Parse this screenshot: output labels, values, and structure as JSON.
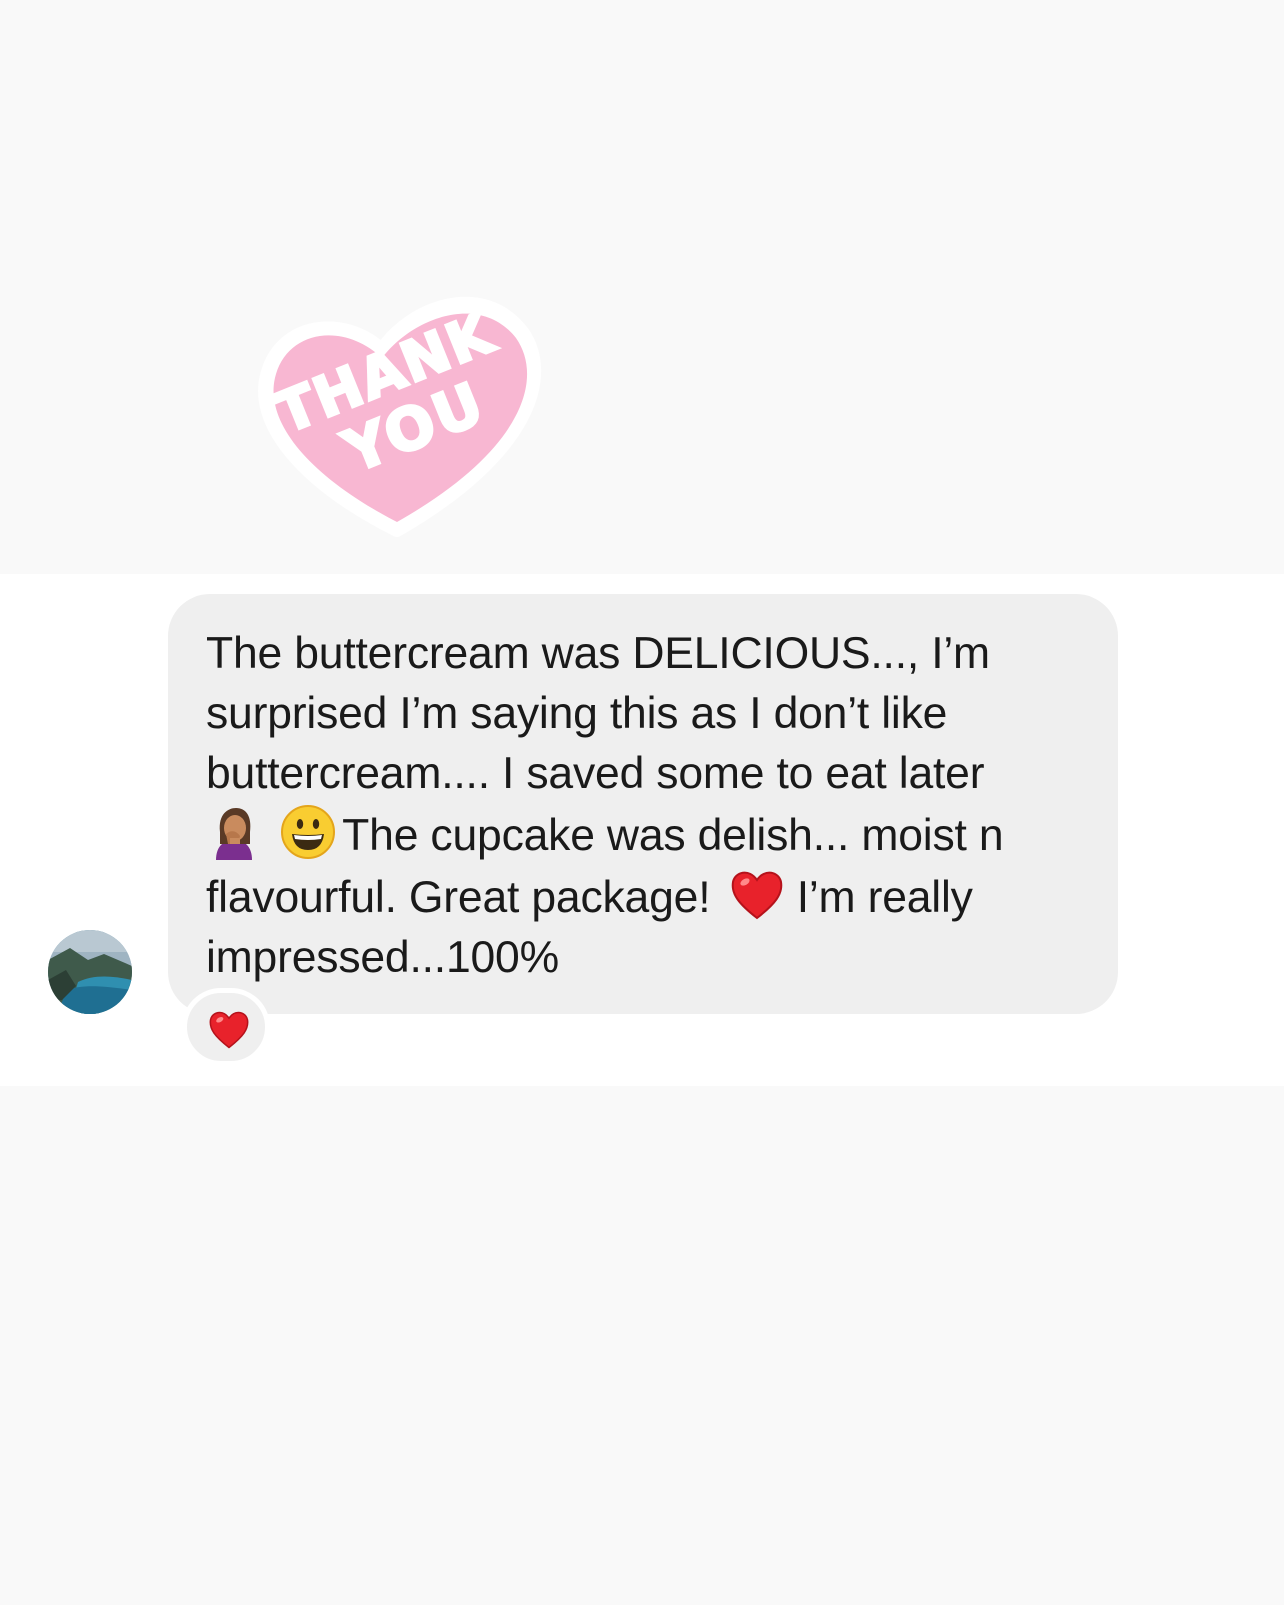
{
  "sticker": {
    "line1": "THANK",
    "line2": "YOU",
    "colors": {
      "heart": "#f8b7d2",
      "text": "#ffffff"
    },
    "icon": "thank-you-heart-sticker"
  },
  "conversation": {
    "avatar": {
      "icon": "landscape-avatar"
    },
    "message": {
      "line1": "The buttercream was DELICIOUS..., I’m",
      "line2": "surprised I’m saying this as I don’t like",
      "line3": "buttercream.... I saved some to eat later",
      "line4_text": "The cupcake was delish... moist n",
      "line5_text_a": "flavourful. Great package!",
      "line5_text_b": " I’m really",
      "line6": "impressed...100%",
      "emojis": [
        "woman-facepalming-emoji",
        "grinning-face-emoji",
        "red-heart-emoji"
      ]
    },
    "reaction": {
      "icon": "red-heart-emoji"
    },
    "colors": {
      "bubble": "#efefef",
      "text": "#1a1a1a",
      "heart": "#e8222b"
    }
  }
}
